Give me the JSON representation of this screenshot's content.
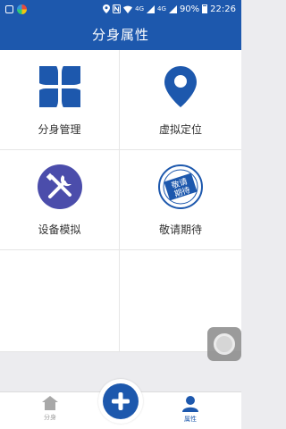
{
  "status_bar": {
    "battery": "90%",
    "time": "22:26",
    "network_labels": [
      "4G",
      "4G"
    ]
  },
  "header": {
    "title": "分身属性"
  },
  "grid": {
    "items": [
      {
        "label": "分身管理",
        "icon": "four-leaf-grid-icon"
      },
      {
        "label": "虚拟定位",
        "icon": "location-pin-icon"
      },
      {
        "label": "设备模拟",
        "icon": "wrench-screwdriver-icon"
      },
      {
        "label": "敬请期待",
        "icon": "coming-soon-stamp-icon",
        "stamp_text": [
          "敬请",
          "期待"
        ]
      }
    ]
  },
  "bottom_nav": {
    "left_label": "分身",
    "right_label": "属性",
    "active": "属性"
  },
  "colors": {
    "brand": "#1d58ad",
    "accent_purple": "#4b4dab",
    "inactive": "#9a9a9a"
  }
}
